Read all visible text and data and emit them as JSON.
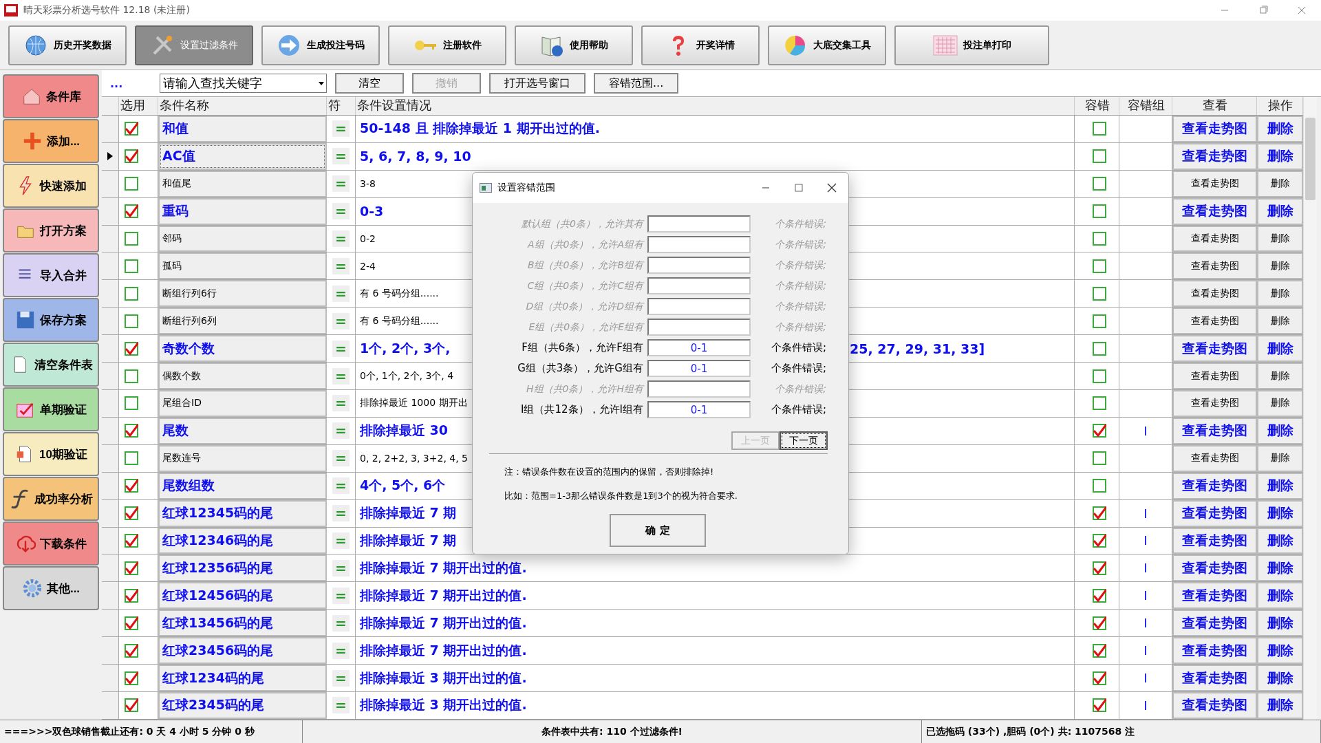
{
  "window": {
    "title": "晴天彩票分析选号软件 12.18 (未注册)"
  },
  "toolbar": [
    {
      "label": "历史开奖数据",
      "selected": false
    },
    {
      "label": "设置过滤条件",
      "selected": true
    },
    {
      "label": "生成投注号码",
      "selected": false
    },
    {
      "label": "注册软件",
      "selected": false
    },
    {
      "label": "使用帮助",
      "selected": false
    },
    {
      "label": "开奖详情",
      "selected": false
    },
    {
      "label": "大底交集工具",
      "selected": false
    },
    {
      "label": "投注单打印",
      "selected": false
    }
  ],
  "sidebar": {
    "items": [
      {
        "label": "条件库",
        "color": "#f08a8a"
      },
      {
        "label": "添加...",
        "color": "#f5b36b"
      },
      {
        "label": "快速添加",
        "color": "#f7e2b0"
      },
      {
        "label": "打开方案",
        "color": "#f6b8b8"
      },
      {
        "label": "导入合并",
        "color": "#d9d2f2"
      },
      {
        "label": "保存方案",
        "color": "#9fb6e8"
      },
      {
        "label": "清空条件表",
        "color": "#bfe8d6"
      },
      {
        "label": "单期验证",
        "color": "#a9dca0"
      },
      {
        "label": "10期验证",
        "color": "#f7ecc0"
      },
      {
        "label": "成功率分析",
        "color": "#f5c27a"
      },
      {
        "label": "下载条件",
        "color": "#f08a8a"
      },
      {
        "label": "其他...",
        "color": "#d8d8d8"
      }
    ]
  },
  "search": {
    "dots": "...",
    "placeholder": "请输入查找关键字",
    "buttons": [
      {
        "label": "清空",
        "disabled": false
      },
      {
        "label": "撤销",
        "disabled": true
      },
      {
        "label": "打开选号窗口",
        "disabled": false
      },
      {
        "label": "容错范围...",
        "disabled": false
      }
    ]
  },
  "table": {
    "columns": [
      "选用",
      "条件名称",
      "符",
      "条件设置情况",
      "容错",
      "容错组",
      "查看",
      "操作"
    ],
    "rows": [
      {
        "selected": false,
        "checked": true,
        "name": "和值",
        "sign": "=",
        "detail": "50-148 且 排除掉最近 1 期开出过的值.",
        "tolerance": false,
        "view": "查看走势图",
        "action": "删除"
      },
      {
        "selected": true,
        "checked": true,
        "name": "AC值",
        "sign": "=",
        "detail": "5, 6, 7, 8, 9, 10",
        "tolerance": false,
        "view": "查看走势图",
        "action": "删除"
      },
      {
        "selected": false,
        "checked": false,
        "name": "和值尾",
        "sign": "=",
        "detail": "3-8",
        "tolerance": false,
        "view": "查看走势图",
        "action": "删除"
      },
      {
        "selected": false,
        "checked": true,
        "name": "重码",
        "sign": "=",
        "detail": "0-3",
        "tolerance": false,
        "view": "查看走势图",
        "action": "删除"
      },
      {
        "selected": false,
        "checked": false,
        "name": "邻码",
        "sign": "=",
        "detail": "0-2",
        "tolerance": false,
        "view": "查看走势图",
        "action": "删除"
      },
      {
        "selected": false,
        "checked": false,
        "name": "孤码",
        "sign": "=",
        "detail": "2-4",
        "tolerance": false,
        "view": "查看走势图",
        "action": "删除"
      },
      {
        "selected": false,
        "checked": false,
        "name": "断组行列6行",
        "sign": "=",
        "detail": "有 6 号码分组......",
        "tolerance": false,
        "view": "查看走势图",
        "action": "删除"
      },
      {
        "selected": false,
        "checked": false,
        "name": "断组行列6列",
        "sign": "=",
        "detail": "有 6 号码分组......",
        "tolerance": false,
        "view": "查看走势图",
        "action": "删除"
      },
      {
        "selected": false,
        "checked": true,
        "name": "奇数个数",
        "sign": "=",
        "detail": "1个, 2个, 3个,",
        "detail_tail": "25, 27, 29, 31, 33]",
        "tolerance": false,
        "view": "查看走势图",
        "action": "删除"
      },
      {
        "selected": false,
        "checked": false,
        "name": "偶数个数",
        "sign": "=",
        "detail": "0个, 1个, 2个, 3个, 4",
        "tolerance": false,
        "view": "查看走势图",
        "action": "删除"
      },
      {
        "selected": false,
        "checked": false,
        "name": "尾组合ID",
        "sign": "=",
        "detail": "排除掉最近 1000 期开出",
        "tolerance": false,
        "view": "查看走势图",
        "action": "删除"
      },
      {
        "selected": false,
        "checked": true,
        "name": "尾数",
        "sign": "=",
        "detail": "排除掉最近 30",
        "tolerance": true,
        "group": "I",
        "view": "查看走势图",
        "action": "删除"
      },
      {
        "selected": false,
        "checked": false,
        "name": "尾数连号",
        "sign": "=",
        "detail": "0, 2, 2+2, 3, 3+2, 4, 5",
        "tolerance": false,
        "view": "查看走势图",
        "action": "删除"
      },
      {
        "selected": false,
        "checked": true,
        "name": "尾数组数",
        "sign": "=",
        "detail": "4个, 5个, 6个",
        "tolerance": false,
        "view": "查看走势图",
        "action": "删除"
      },
      {
        "selected": false,
        "checked": true,
        "name": "红球12345码的尾",
        "sign": "=",
        "detail": "排除掉最近 7 期",
        "tolerance": true,
        "group": "I",
        "view": "查看走势图",
        "action": "删除"
      },
      {
        "selected": false,
        "checked": true,
        "name": "红球12346码的尾",
        "sign": "=",
        "detail": "排除掉最近 7 期",
        "tolerance": true,
        "group": "I",
        "view": "查看走势图",
        "action": "删除"
      },
      {
        "selected": false,
        "checked": true,
        "name": "红球12356码的尾",
        "sign": "=",
        "detail": "排除掉最近 7 期开出过的值.",
        "tolerance": true,
        "group": "I",
        "view": "查看走势图",
        "action": "删除"
      },
      {
        "selected": false,
        "checked": true,
        "name": "红球12456码的尾",
        "sign": "=",
        "detail": "排除掉最近 7 期开出过的值.",
        "tolerance": true,
        "group": "I",
        "view": "查看走势图",
        "action": "删除"
      },
      {
        "selected": false,
        "checked": true,
        "name": "红球13456码的尾",
        "sign": "=",
        "detail": "排除掉最近 7 期开出过的值.",
        "tolerance": true,
        "group": "I",
        "view": "查看走势图",
        "action": "删除"
      },
      {
        "selected": false,
        "checked": true,
        "name": "红球23456码的尾",
        "sign": "=",
        "detail": "排除掉最近 7 期开出过的值.",
        "tolerance": true,
        "group": "I",
        "view": "查看走势图",
        "action": "删除"
      },
      {
        "selected": false,
        "checked": true,
        "name": "红球1234码的尾",
        "sign": "=",
        "detail": "排除掉最近 3 期开出过的值.",
        "tolerance": true,
        "group": "I",
        "view": "查看走势图",
        "action": "删除"
      },
      {
        "selected": false,
        "checked": true,
        "name": "红球2345码的尾",
        "sign": "=",
        "detail": "排除掉最近 3 期开出过的值.",
        "tolerance": true,
        "group": "I",
        "view": "查看走势图",
        "action": "删除"
      }
    ]
  },
  "dialog": {
    "title": "设置容错范围",
    "groups": [
      {
        "label": "默认组（共0条），允许其有",
        "suffix": "个条件错误;",
        "disabled": true
      },
      {
        "label": "A组（共0条），允许A组有",
        "suffix": "个条件错误;",
        "disabled": true
      },
      {
        "label": "B组（共0条），允许B组有",
        "suffix": "个条件错误;",
        "disabled": true
      },
      {
        "label": "C组（共0条），允许C组有",
        "suffix": "个条件错误;",
        "disabled": true
      },
      {
        "label": "D组（共0条），允许D组有",
        "suffix": "个条件错误;",
        "disabled": true
      },
      {
        "label": "E组（共0条），允许E组有",
        "suffix": "个条件错误;",
        "disabled": true
      },
      {
        "label": "F组（共6条），允许F组有",
        "value": "0-1",
        "suffix": "个条件错误;",
        "disabled": false
      },
      {
        "label": "G组（共3条），允许G组有",
        "value": "0-1",
        "suffix": "个条件错误;",
        "disabled": false
      },
      {
        "label": "H组（共0条），允许H组有",
        "suffix": "个条件错误;",
        "disabled": true
      },
      {
        "label": "I组（共12条），允许I组有",
        "value": "0-1",
        "suffix": "个条件错误;",
        "disabled": false
      }
    ],
    "pager": [
      {
        "label": "上一页",
        "disabled": true
      },
      {
        "label": "下一页",
        "disabled": false
      }
    ],
    "notes": [
      "注：错误条件数在设置的范围内的保留，否则排除掉!",
      "比如：范围=1-3那么错误条件数是1到3个的视为符合要求."
    ],
    "ok": "确 定"
  },
  "status_bar": [
    "===>>>双色球销售截止还有: 0 天 4 小时 5 分钟 0 秒",
    "条件表中共有: 110 个过滤条件!",
    "已选拖码 (33个) ,胆码 (0个) 共: 1107568 注"
  ]
}
